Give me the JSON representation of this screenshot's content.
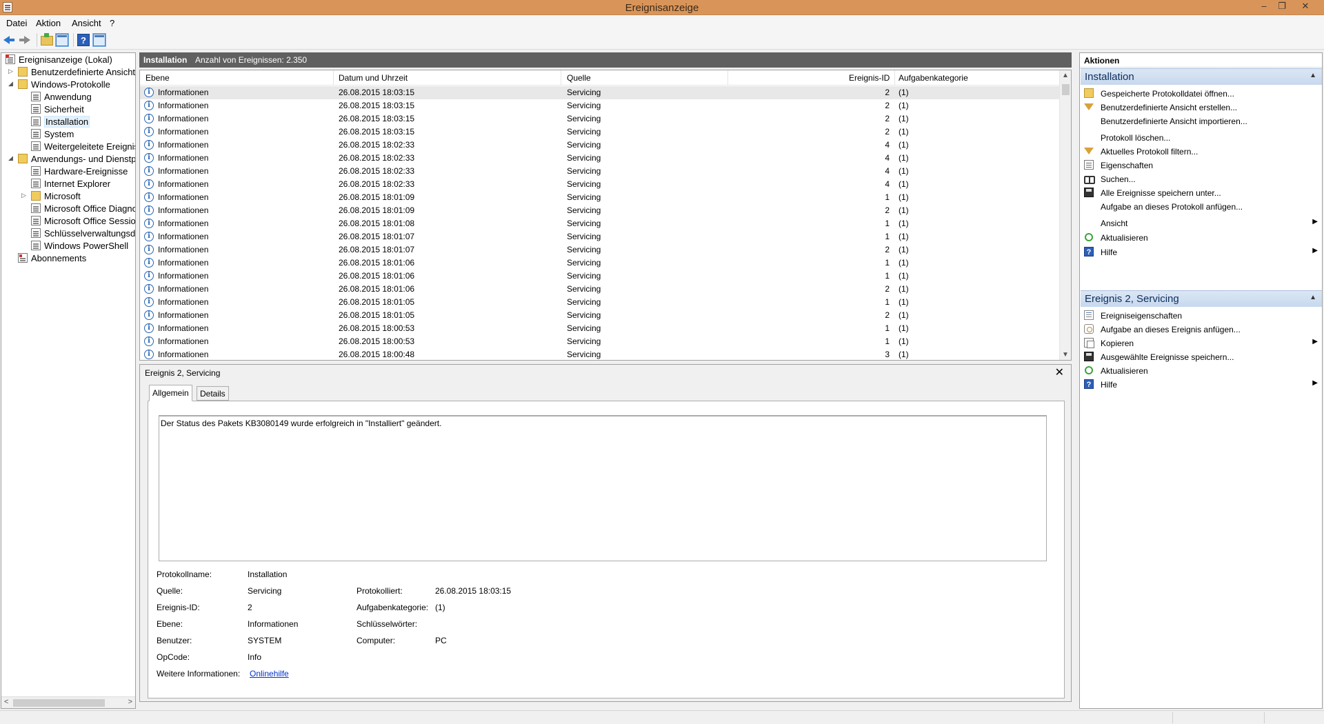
{
  "window": {
    "title": "Ereignisanzeige",
    "min": "–",
    "restore": "❐",
    "close": "✕"
  },
  "menu": [
    "Datei",
    "Aktion",
    "Ansicht",
    "?"
  ],
  "tree": {
    "items": [
      {
        "label": "Ereignisanzeige (Lokal)"
      },
      {
        "label": "Benutzerdefinierte Ansichten"
      },
      {
        "label": "Windows-Protokolle"
      },
      {
        "label": "Anwendung"
      },
      {
        "label": "Sicherheit"
      },
      {
        "label": "Installation"
      },
      {
        "label": "System"
      },
      {
        "label": "Weitergeleitete Ereignisse"
      },
      {
        "label": "Anwendungs- und Dienstprotokolle"
      },
      {
        "label": "Hardware-Ereignisse"
      },
      {
        "label": "Internet Explorer"
      },
      {
        "label": "Microsoft"
      },
      {
        "label": "Microsoft Office Diagnostics"
      },
      {
        "label": "Microsoft Office Sessions"
      },
      {
        "label": "Schlüsselverwaltungsdienst"
      },
      {
        "label": "Windows PowerShell"
      },
      {
        "label": "Abonnements"
      }
    ]
  },
  "center": {
    "log_name": "Installation",
    "count_text": "Anzahl von Ereignissen: 2.350",
    "columns": [
      "Ebene",
      "Datum und Uhrzeit",
      "Quelle",
      "Ereignis-ID",
      "Aufgabenkategorie"
    ],
    "rows": [
      [
        "Informationen",
        "26.08.2015 18:03:15",
        "Servicing",
        "2",
        "(1)"
      ],
      [
        "Informationen",
        "26.08.2015 18:03:15",
        "Servicing",
        "2",
        "(1)"
      ],
      [
        "Informationen",
        "26.08.2015 18:03:15",
        "Servicing",
        "2",
        "(1)"
      ],
      [
        "Informationen",
        "26.08.2015 18:03:15",
        "Servicing",
        "2",
        "(1)"
      ],
      [
        "Informationen",
        "26.08.2015 18:02:33",
        "Servicing",
        "4",
        "(1)"
      ],
      [
        "Informationen",
        "26.08.2015 18:02:33",
        "Servicing",
        "4",
        "(1)"
      ],
      [
        "Informationen",
        "26.08.2015 18:02:33",
        "Servicing",
        "4",
        "(1)"
      ],
      [
        "Informationen",
        "26.08.2015 18:02:33",
        "Servicing",
        "4",
        "(1)"
      ],
      [
        "Informationen",
        "26.08.2015 18:01:09",
        "Servicing",
        "1",
        "(1)"
      ],
      [
        "Informationen",
        "26.08.2015 18:01:09",
        "Servicing",
        "2",
        "(1)"
      ],
      [
        "Informationen",
        "26.08.2015 18:01:08",
        "Servicing",
        "1",
        "(1)"
      ],
      [
        "Informationen",
        "26.08.2015 18:01:07",
        "Servicing",
        "1",
        "(1)"
      ],
      [
        "Informationen",
        "26.08.2015 18:01:07",
        "Servicing",
        "2",
        "(1)"
      ],
      [
        "Informationen",
        "26.08.2015 18:01:06",
        "Servicing",
        "1",
        "(1)"
      ],
      [
        "Informationen",
        "26.08.2015 18:01:06",
        "Servicing",
        "1",
        "(1)"
      ],
      [
        "Informationen",
        "26.08.2015 18:01:06",
        "Servicing",
        "2",
        "(1)"
      ],
      [
        "Informationen",
        "26.08.2015 18:01:05",
        "Servicing",
        "1",
        "(1)"
      ],
      [
        "Informationen",
        "26.08.2015 18:01:05",
        "Servicing",
        "2",
        "(1)"
      ],
      [
        "Informationen",
        "26.08.2015 18:00:53",
        "Servicing",
        "1",
        "(1)"
      ],
      [
        "Informationen",
        "26.08.2015 18:00:53",
        "Servicing",
        "1",
        "(1)"
      ],
      [
        "Informationen",
        "26.08.2015 18:00:48",
        "Servicing",
        "3",
        "(1)"
      ]
    ]
  },
  "detail": {
    "title": "Ereignis 2, Servicing",
    "tabs": [
      "Allgemein",
      "Details"
    ],
    "message": "Der Status des Pakets KB3080149 wurde erfolgreich in \"Installiert\" geändert.",
    "labels": {
      "log_name": "Protokollname:",
      "source": "Quelle:",
      "event_id": "Ereignis-ID:",
      "level": "Ebene:",
      "user": "Benutzer:",
      "opcode": "OpCode:",
      "more_info": "Weitere Informationen:",
      "logged": "Protokolliert:",
      "task_category": "Aufgabenkategorie:",
      "keywords": "Schlüsselwörter:",
      "computer": "Computer:"
    },
    "values": {
      "log_name": "Installation",
      "source": "Servicing",
      "event_id": "2",
      "level": "Informationen",
      "user": "SYSTEM",
      "opcode": "Info",
      "more_info_link": "Onlinehilfe",
      "logged": "26.08.2015 18:03:15",
      "task_category": "(1)",
      "keywords": "",
      "computer": "PC"
    }
  },
  "actions": {
    "header": "Aktionen",
    "section1": {
      "title": "Installation",
      "items": [
        {
          "label": "Gespeicherte Protokolldatei öffnen...",
          "icon": "open-icon"
        },
        {
          "label": "Benutzerdefinierte Ansicht erstellen...",
          "icon": "filter-icon"
        },
        {
          "label": "Benutzerdefinierte Ansicht importieren...",
          "icon": ""
        },
        {
          "label": "Protokoll löschen...",
          "icon": ""
        },
        {
          "label": "Aktuelles Protokoll filtern...",
          "icon": "filter-icon"
        },
        {
          "label": "Eigenschaften",
          "icon": "properties-icon"
        },
        {
          "label": "Suchen...",
          "icon": "binoculars-icon"
        },
        {
          "label": "Alle Ereignisse speichern unter...",
          "icon": "save-icon"
        },
        {
          "label": "Aufgabe an dieses Protokoll anfügen...",
          "icon": ""
        },
        {
          "label": "Ansicht",
          "icon": "",
          "submenu": true
        },
        {
          "label": "Aktualisieren",
          "icon": "refresh-icon"
        },
        {
          "label": "Hilfe",
          "icon": "help-icon",
          "submenu": true
        }
      ]
    },
    "section2": {
      "title": "Ereignis 2, Servicing",
      "items": [
        {
          "label": "Ereigniseigenschaften",
          "icon": "event-properties-icon"
        },
        {
          "label": "Aufgabe an dieses Ereignis anfügen...",
          "icon": "task-icon"
        },
        {
          "label": "Kopieren",
          "icon": "copy-icon",
          "submenu": true
        },
        {
          "label": "Ausgewählte Ereignisse speichern...",
          "icon": "save-icon"
        },
        {
          "label": "Aktualisieren",
          "icon": "refresh-icon"
        },
        {
          "label": "Hilfe",
          "icon": "help-icon",
          "submenu": true
        }
      ]
    }
  }
}
